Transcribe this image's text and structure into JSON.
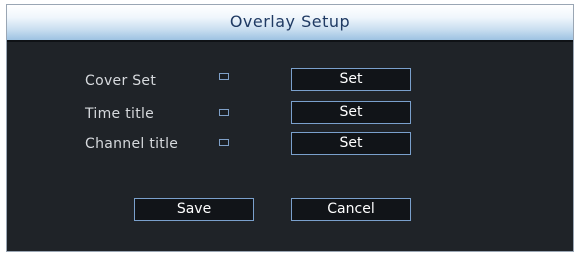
{
  "dialog": {
    "title": "Overlay Setup"
  },
  "rows": [
    {
      "label": "Cover Set",
      "checked": false,
      "button_label": "Set"
    },
    {
      "label": "Time title",
      "checked": false,
      "button_label": "Set"
    },
    {
      "label": "Channel title",
      "checked": false,
      "button_label": "Set"
    }
  ],
  "actions": {
    "save_label": "Save",
    "cancel_label": "Cancel"
  },
  "colors": {
    "panel_background": "#1f2328",
    "title_gradient_top": "#ffffff",
    "title_gradient_bottom": "#9ec2e2",
    "title_text": "#1f3a63",
    "button_border": "#7aa0cc",
    "label_text": "#d6d9dd"
  }
}
